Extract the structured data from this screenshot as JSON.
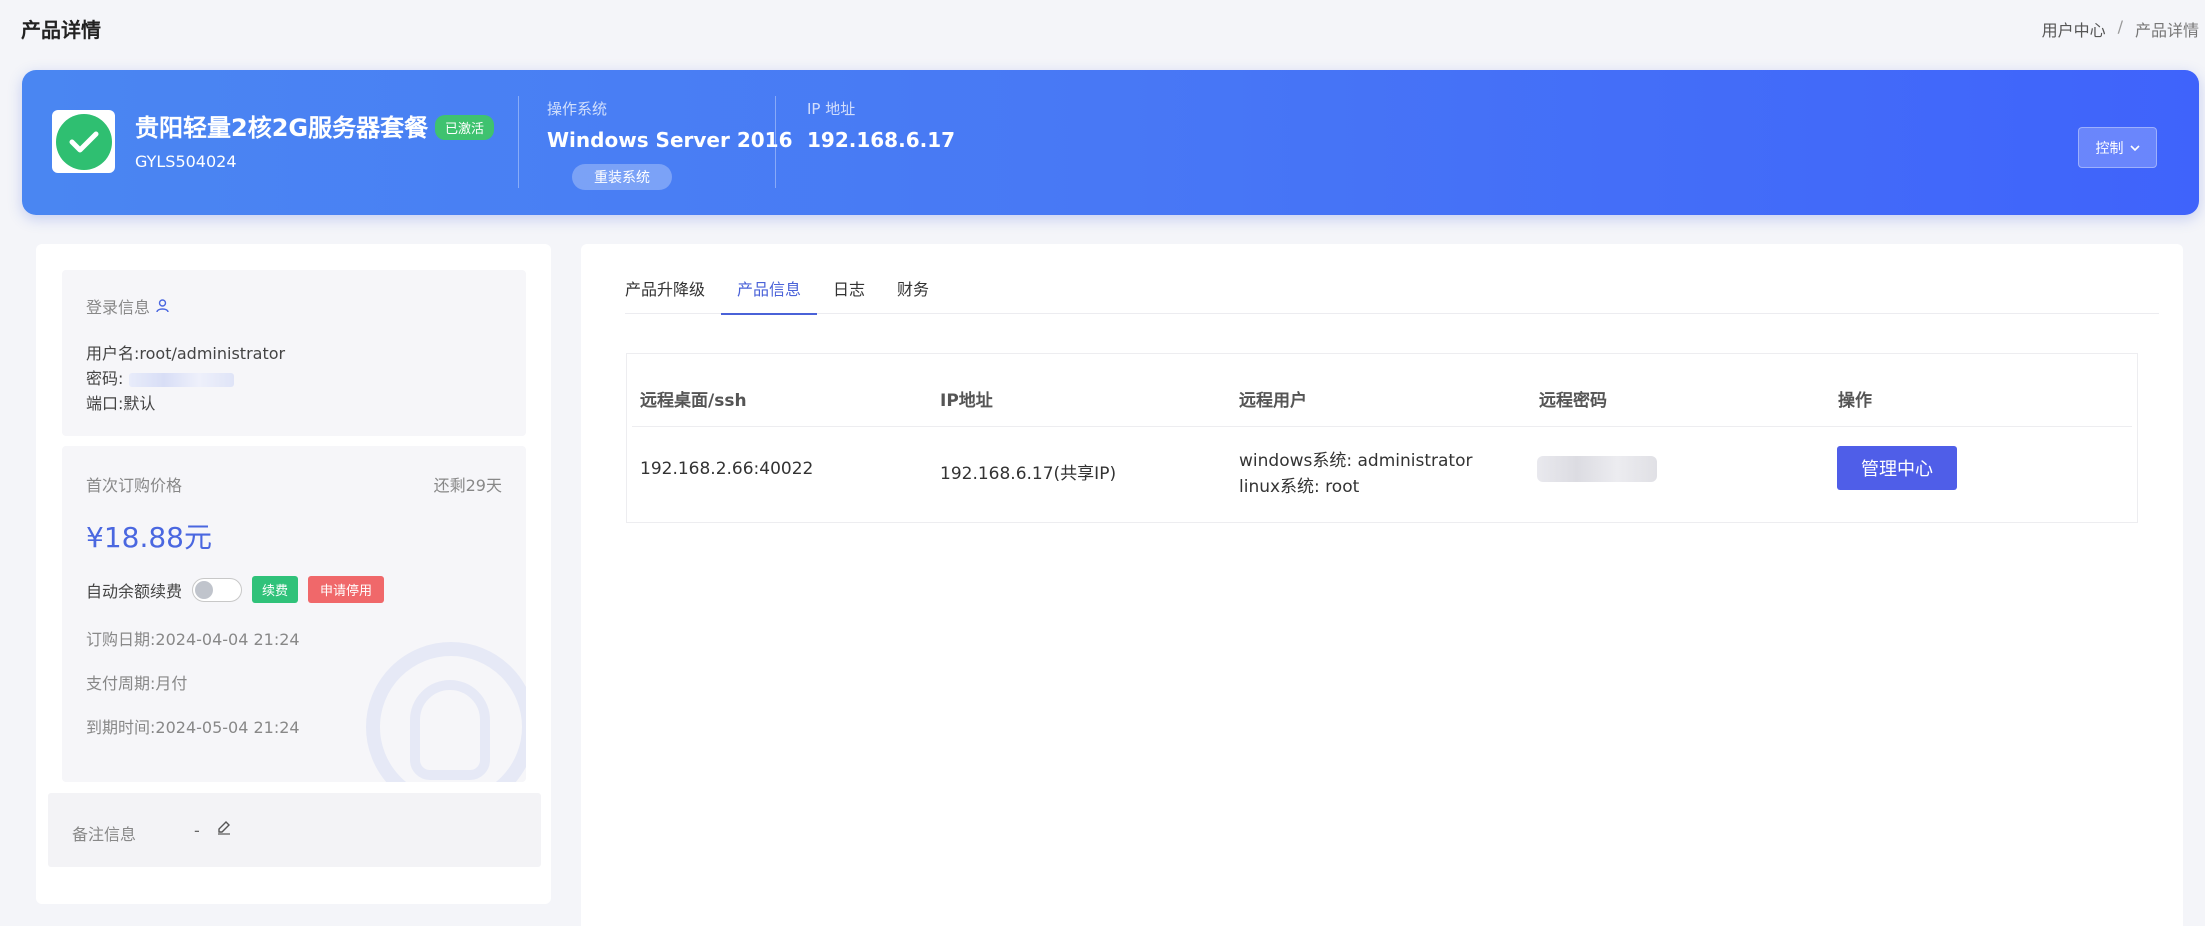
{
  "page": {
    "title": "产品详情"
  },
  "breadcrumb": {
    "home": "用户中心",
    "separator": "/",
    "current": "产品详情"
  },
  "product": {
    "name": "贵阳轻量2核2G服务器套餐",
    "status": "已激活",
    "code": "GYLS504024",
    "os_label": "操作系统",
    "os_value": "Windows Server 2016",
    "reinstall_label": "重装系统",
    "ip_label": "IP 地址",
    "ip_value": "192.168.6.17",
    "control_label": "控制",
    "colors": {
      "banner_start": "#4a86f2",
      "banner_end": "#3f63fb",
      "status_green": "#3fc26f"
    }
  },
  "login": {
    "title": "登录信息",
    "username_label": "用户名:",
    "username_value": "root/administrator",
    "password_label": "密码:",
    "port_label": "端口:",
    "port_value": "默认"
  },
  "billing": {
    "price_label": "首次订购价格",
    "remaining": "还剩29天",
    "price": "¥18.88元",
    "auto_renew_label": "自动余额续费",
    "auto_renew_on": false,
    "renew_button": "续费",
    "suspend_button": "申请停用",
    "order_date_label": "订购日期:",
    "order_date": "2024-04-04 21:24",
    "cycle_label": "支付周期:",
    "cycle": "月付",
    "expire_label": "到期时间:",
    "expire": "2024-05-04 21:24"
  },
  "notes": {
    "label": "备注信息",
    "value": "-"
  },
  "tabs": [
    {
      "label": "产品升降级",
      "active": false
    },
    {
      "label": "产品信息",
      "active": true
    },
    {
      "label": "日志",
      "active": false
    },
    {
      "label": "财务",
      "active": false
    }
  ],
  "table": {
    "headers": [
      "远程桌面/ssh",
      "IP地址",
      "远程用户",
      "远程密码",
      "操作"
    ],
    "row": {
      "remote": "192.168.2.66:40022",
      "ip": "192.168.6.17(共享IP)",
      "user_line1": "windows系统: administrator",
      "user_line2": "linux系统: root",
      "action": "管理中心"
    }
  }
}
